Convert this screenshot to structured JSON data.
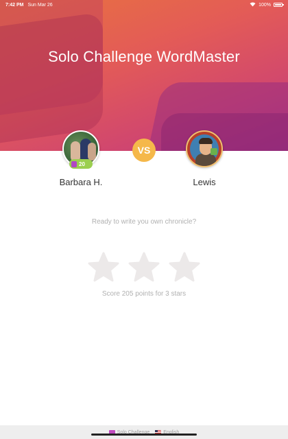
{
  "status_bar": {
    "time": "7:42 PM",
    "date": "Sun Mar 26",
    "battery": "100%"
  },
  "header": {
    "title": "Solo Challenge WordMaster"
  },
  "players": {
    "left": {
      "name": "Barbara H.",
      "level": "20"
    },
    "right": {
      "name": "Lewis"
    }
  },
  "vs_label": "VS",
  "prompt": "Ready to write you own chronicle?",
  "stars": {
    "earned": 0,
    "total": 3
  },
  "score_text": "Score 205 points for 3 stars",
  "footer": {
    "mode": "Solo Challenge",
    "language": "English"
  },
  "colors": {
    "header_gradient": [
      "#e8733f",
      "#d0466f",
      "#b83c82"
    ],
    "vs_badge": "#f5b84a",
    "star_empty": "#ece9e9",
    "muted_text": "#b0b0b0",
    "level_badge": "#9bcf4f"
  },
  "icons": {
    "wifi": "wifi-icon",
    "battery": "battery-icon",
    "star": "star-icon",
    "level_gem": "gem-icon"
  }
}
